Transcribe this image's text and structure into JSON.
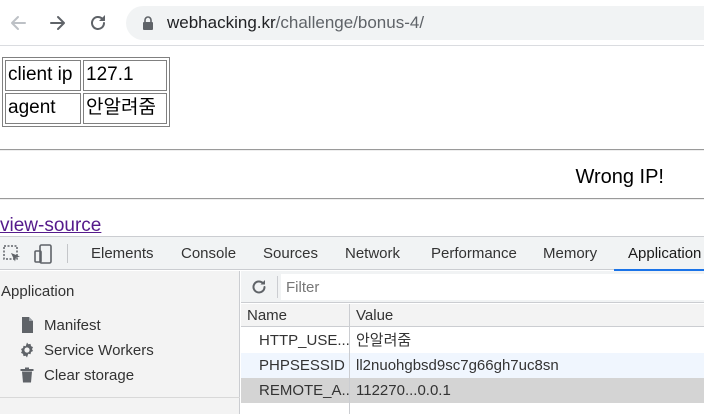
{
  "browser": {
    "url_host": "webhacking.kr",
    "url_path": "/challenge/bonus-4/"
  },
  "page": {
    "table": [
      {
        "key": "client ip",
        "value": "127.1"
      },
      {
        "key": "agent",
        "value": "안알려줌"
      }
    ],
    "result_text": "Wrong IP!",
    "view_source_link": "view-source"
  },
  "devtools": {
    "tabs": [
      "Elements",
      "Console",
      "Sources",
      "Network",
      "Performance",
      "Memory",
      "Application"
    ],
    "active_tab": "Application",
    "sidebar": {
      "header": "Application",
      "items": [
        {
          "label": "Manifest",
          "icon": "document-icon"
        },
        {
          "label": "Service Workers",
          "icon": "gear-icon"
        },
        {
          "label": "Clear storage",
          "icon": "trash-icon"
        }
      ]
    },
    "filter_placeholder": "Filter",
    "columns": {
      "name": "Name",
      "value": "Value"
    },
    "rows": [
      {
        "name": "HTTP_USE...",
        "value": "안알려줌"
      },
      {
        "name": "PHPSESSID",
        "value": "ll2nuohgbsd9sc7g66gh7uc8sn"
      },
      {
        "name": "REMOTE_A...",
        "value": "112270...0.0.1"
      }
    ]
  }
}
